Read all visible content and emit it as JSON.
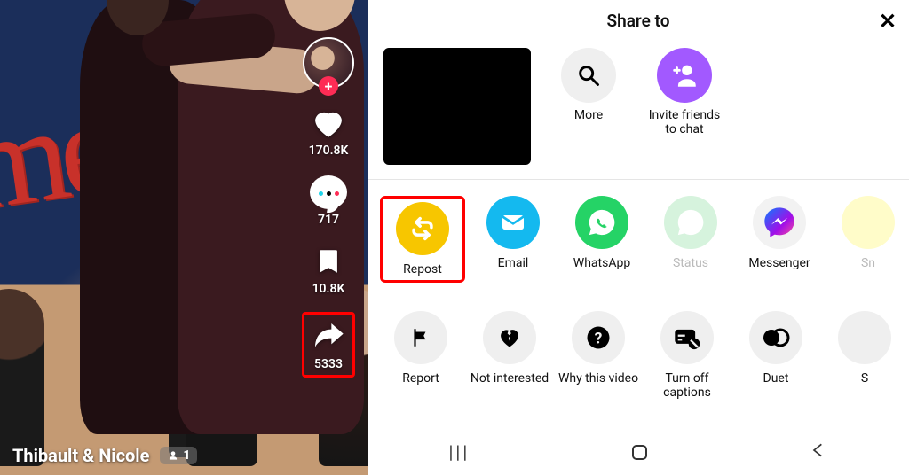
{
  "feed": {
    "username": "Thibault & Nicole",
    "live_badge": "1",
    "stats": {
      "likes": "170.8K",
      "comments": "717",
      "bookmarks": "10.8K",
      "shares": "5333"
    },
    "follow_plus": "+"
  },
  "sheet": {
    "title": "Share to",
    "top": {
      "more": "More",
      "invite": "Invite friends to chat"
    },
    "share_row": {
      "repost": "Repost",
      "email": "Email",
      "whatsapp": "WhatsApp",
      "status": "Status",
      "messenger": "Messenger",
      "snap": "Sn"
    },
    "action_row": {
      "report": "Report",
      "not_interested": "Not interested",
      "why": "Why this video",
      "captions": "Turn off captions",
      "duet": "Duet",
      "extra": "S"
    }
  },
  "colors": {
    "repost": "#f7c600",
    "email": "#14b9ef",
    "whatsapp": "#25d366",
    "status": "#bdeccb",
    "messenger_grad_a": "#0a7cff",
    "messenger_grad_b": "#a10ee8",
    "invite": "#a259ff"
  }
}
